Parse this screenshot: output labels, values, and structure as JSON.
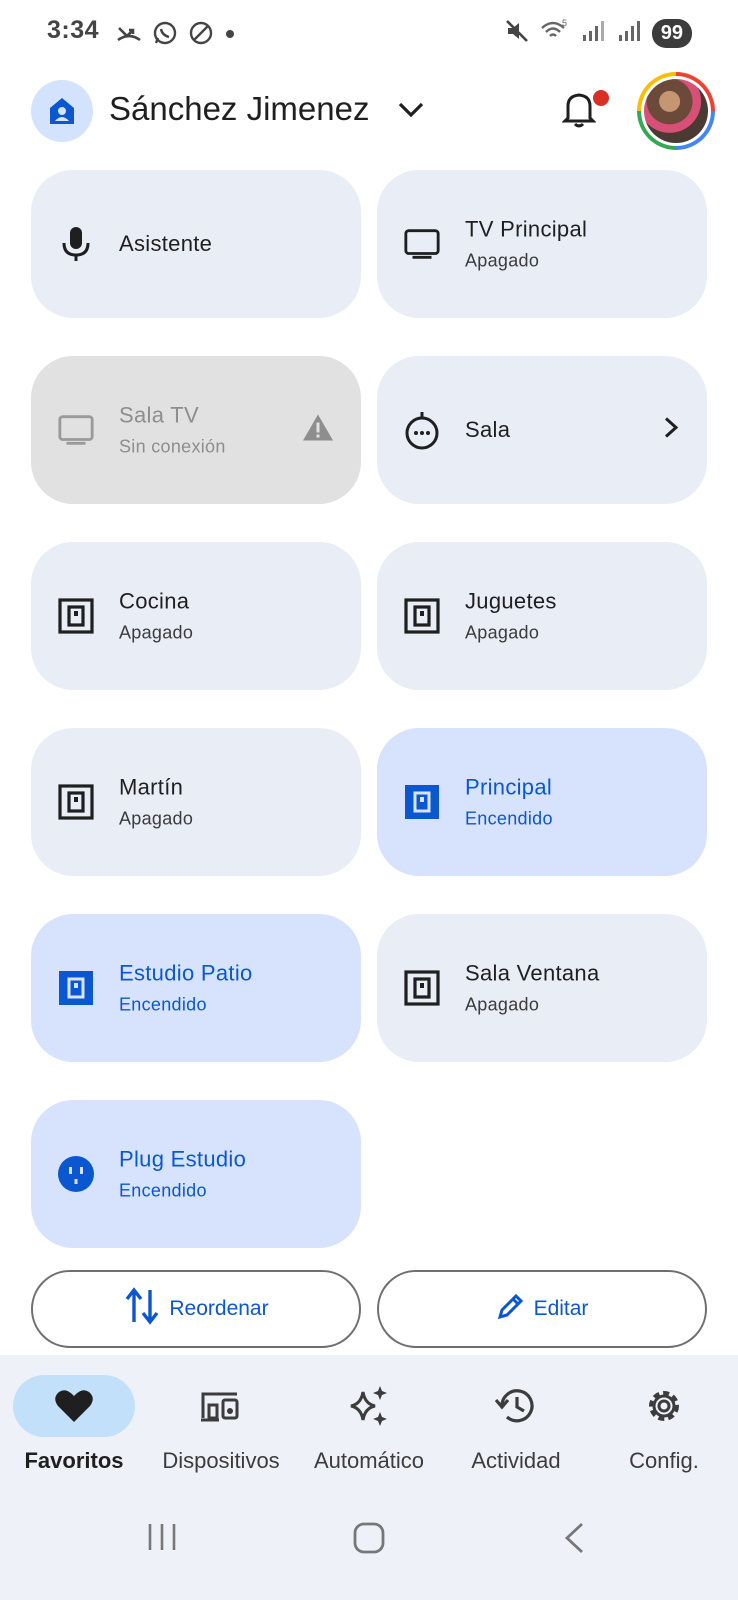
{
  "status_bar": {
    "time": "3:34",
    "battery": "99"
  },
  "header": {
    "home_name": "Sánchez Jimenez"
  },
  "tiles": [
    {
      "name": "Asistente",
      "status": "",
      "icon": "microphone-icon"
    },
    {
      "name": "TV Principal",
      "status": "Apagado",
      "icon": "tv-icon"
    },
    {
      "name": "Sala TV",
      "status": "Sin conexión",
      "icon": "tv-icon",
      "state": "offline"
    },
    {
      "name": "Sala",
      "status": "",
      "icon": "speaker-group-icon"
    },
    {
      "name": "Cocina",
      "status": "Apagado",
      "icon": "switch-icon"
    },
    {
      "name": "Juguetes",
      "status": "Apagado",
      "icon": "switch-icon"
    },
    {
      "name": "Martín",
      "status": "Apagado",
      "icon": "switch-icon"
    },
    {
      "name": "Principal",
      "status": "Encendido",
      "icon": "switch-icon",
      "state": "on"
    },
    {
      "name": "Estudio Patio",
      "status": "Encendido",
      "icon": "switch-icon",
      "state": "on"
    },
    {
      "name": "Sala Ventana",
      "status": "Apagado",
      "icon": "switch-icon"
    },
    {
      "name": "Plug Estudio",
      "status": "Encendido",
      "icon": "plug-icon",
      "state": "on"
    }
  ],
  "actions": {
    "reorder_label": "Reordenar",
    "edit_label": "Editar"
  },
  "bottom_nav": [
    {
      "label": "Favoritos",
      "icon": "heart-icon",
      "active": true
    },
    {
      "label": "Dispositivos",
      "icon": "devices-icon"
    },
    {
      "label": "Automático",
      "icon": "sparkle-icon"
    },
    {
      "label": "Actividad",
      "icon": "history-icon"
    },
    {
      "label": "Config.",
      "icon": "gear-icon"
    }
  ],
  "colors": {
    "accent": "#0b57d0",
    "tile_off": "#e8edf6",
    "tile_on": "#d7e3fd",
    "tile_offline": "#e1e1e1",
    "nav_active": "#c2e0fa",
    "notification_dot": "#d93025"
  }
}
